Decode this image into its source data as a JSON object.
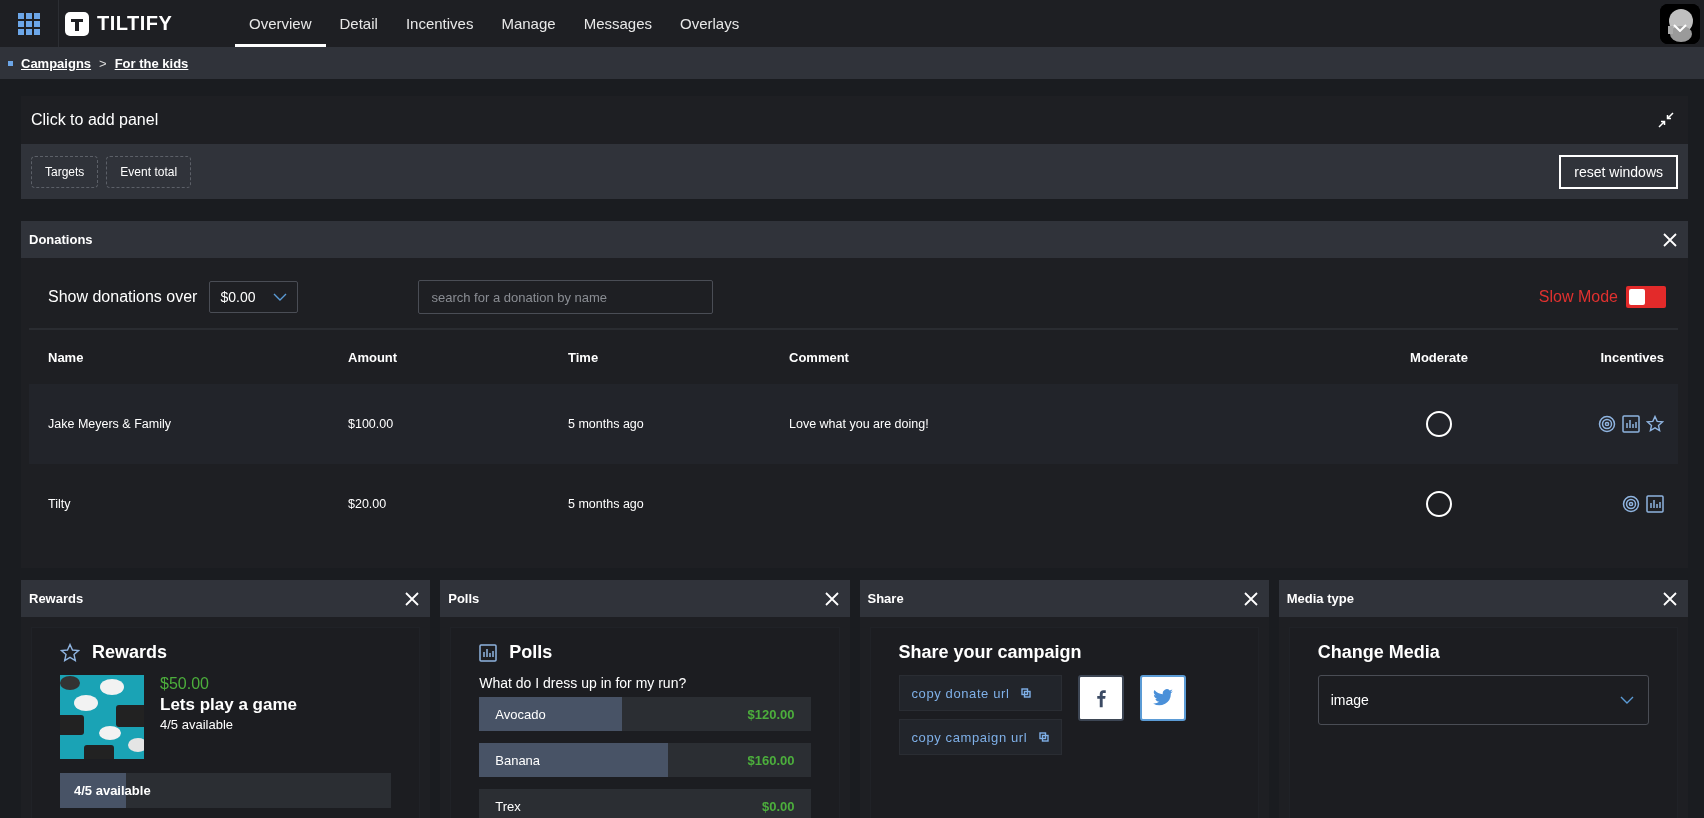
{
  "nav": {
    "brand": "TILTIFY",
    "tabs": [
      {
        "label": "Overview",
        "selected": true
      },
      {
        "label": "Detail",
        "selected": false
      },
      {
        "label": "Incentives",
        "selected": false
      },
      {
        "label": "Manage",
        "selected": false
      },
      {
        "label": "Messages",
        "selected": false
      },
      {
        "label": "Overlays",
        "selected": false
      }
    ]
  },
  "breadcrumbs": [
    "Campaigns",
    "For the kids"
  ],
  "breadcrumb_separator": ">",
  "add_panel": {
    "title": "Click to add panel",
    "chips": [
      "Targets",
      "Event total"
    ],
    "reset_button": "reset windows"
  },
  "donations": {
    "title": "Donations",
    "filter_label": "Show donations over",
    "filter_value": "$0.00",
    "search": {
      "placeholder": "search for a donation by name"
    },
    "slow_mode": {
      "label": "Slow Mode",
      "on": false
    },
    "columns": [
      "Name",
      "Amount",
      "Time",
      "Comment",
      "Moderate",
      "Incentives"
    ],
    "rows": [
      {
        "name": "Jake Meyers & Family",
        "amount": "$100.00",
        "time": "5 months ago",
        "comment": "Love what you are doing!",
        "moderated": false,
        "incentives": [
          {
            "kind": "target"
          },
          {
            "kind": "poll"
          },
          {
            "kind": "reward"
          }
        ]
      },
      {
        "name": "Tilty",
        "amount": "$20.00",
        "time": "5 months ago",
        "comment": "",
        "moderated": false,
        "incentives": [
          {
            "kind": "target"
          },
          {
            "kind": "poll"
          }
        ]
      }
    ]
  },
  "rewards": {
    "title": "Rewards",
    "heading": "Rewards",
    "items": [
      {
        "price": "$50.00",
        "name": "Lets play a game",
        "availability": "4/5 available",
        "bar_label": "4/5 available",
        "level": 0.2
      }
    ]
  },
  "polls": {
    "title": "Polls",
    "heading": "Polls",
    "question": "What do I dress up in for my run?",
    "options": [
      {
        "label": "Avocado",
        "amount": "$120.00",
        "level": 0.43
      },
      {
        "label": "Banana",
        "amount": "$160.00",
        "level": 0.57
      },
      {
        "label": "Trex",
        "amount": "$0.00",
        "level": 0
      }
    ]
  },
  "share": {
    "title": "Share",
    "heading": "Share your campaign",
    "links": [
      "copy donate url",
      "copy campaign url"
    ],
    "socials": [
      {
        "kind": "facebook",
        "selected": false
      },
      {
        "kind": "twitter",
        "selected": true
      }
    ]
  },
  "media": {
    "title": "Media type",
    "heading": "Change Media",
    "value": "image"
  }
}
